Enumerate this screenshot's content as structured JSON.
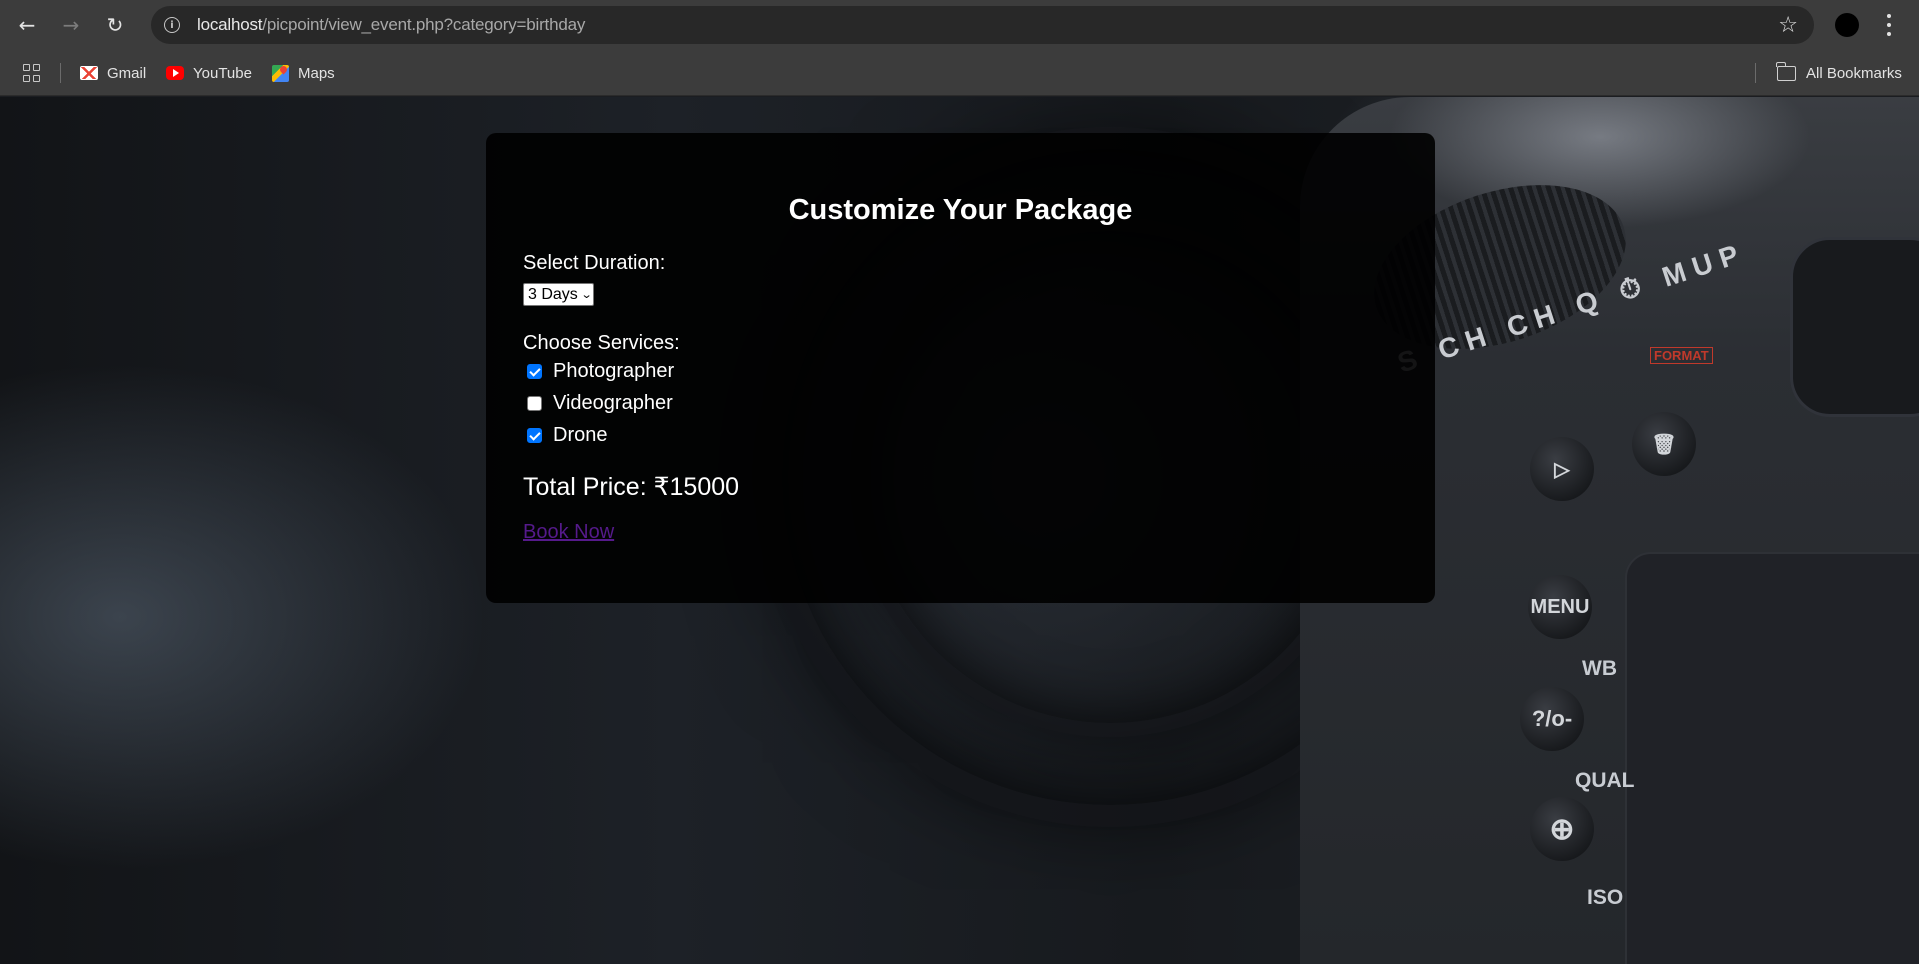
{
  "browser": {
    "url_host": "localhost",
    "url_path": "/picpoint/view_event.php?category=birthday",
    "bookmarks": [
      {
        "label": "Gmail",
        "icon": "gmail-icon"
      },
      {
        "label": "YouTube",
        "icon": "youtube-icon"
      },
      {
        "label": "Maps",
        "icon": "maps-icon"
      }
    ],
    "all_bookmarks_label": "All Bookmarks"
  },
  "background": {
    "camera_labels": {
      "menu": "MENU",
      "wb": "WB",
      "qual": "QUAL",
      "iso": "ISO",
      "key": "?/o-",
      "format": "FORMAT",
      "dial": "S CH CH Q ⏱ MUP"
    }
  },
  "panel": {
    "title": "Customize Your Package",
    "duration_label": "Select Duration:",
    "duration_value": "3 Days",
    "services_label": "Choose Services:",
    "services": [
      {
        "label": "Photographer",
        "checked": true
      },
      {
        "label": "Videographer",
        "checked": false
      },
      {
        "label": "Drone",
        "checked": true
      }
    ],
    "total_price": "Total Price: ₹15000",
    "book_label": "Book Now"
  },
  "colors": {
    "panel_bg": "#000000",
    "checkbox_accent": "#0075ff",
    "link_visited": "#551a8b"
  }
}
